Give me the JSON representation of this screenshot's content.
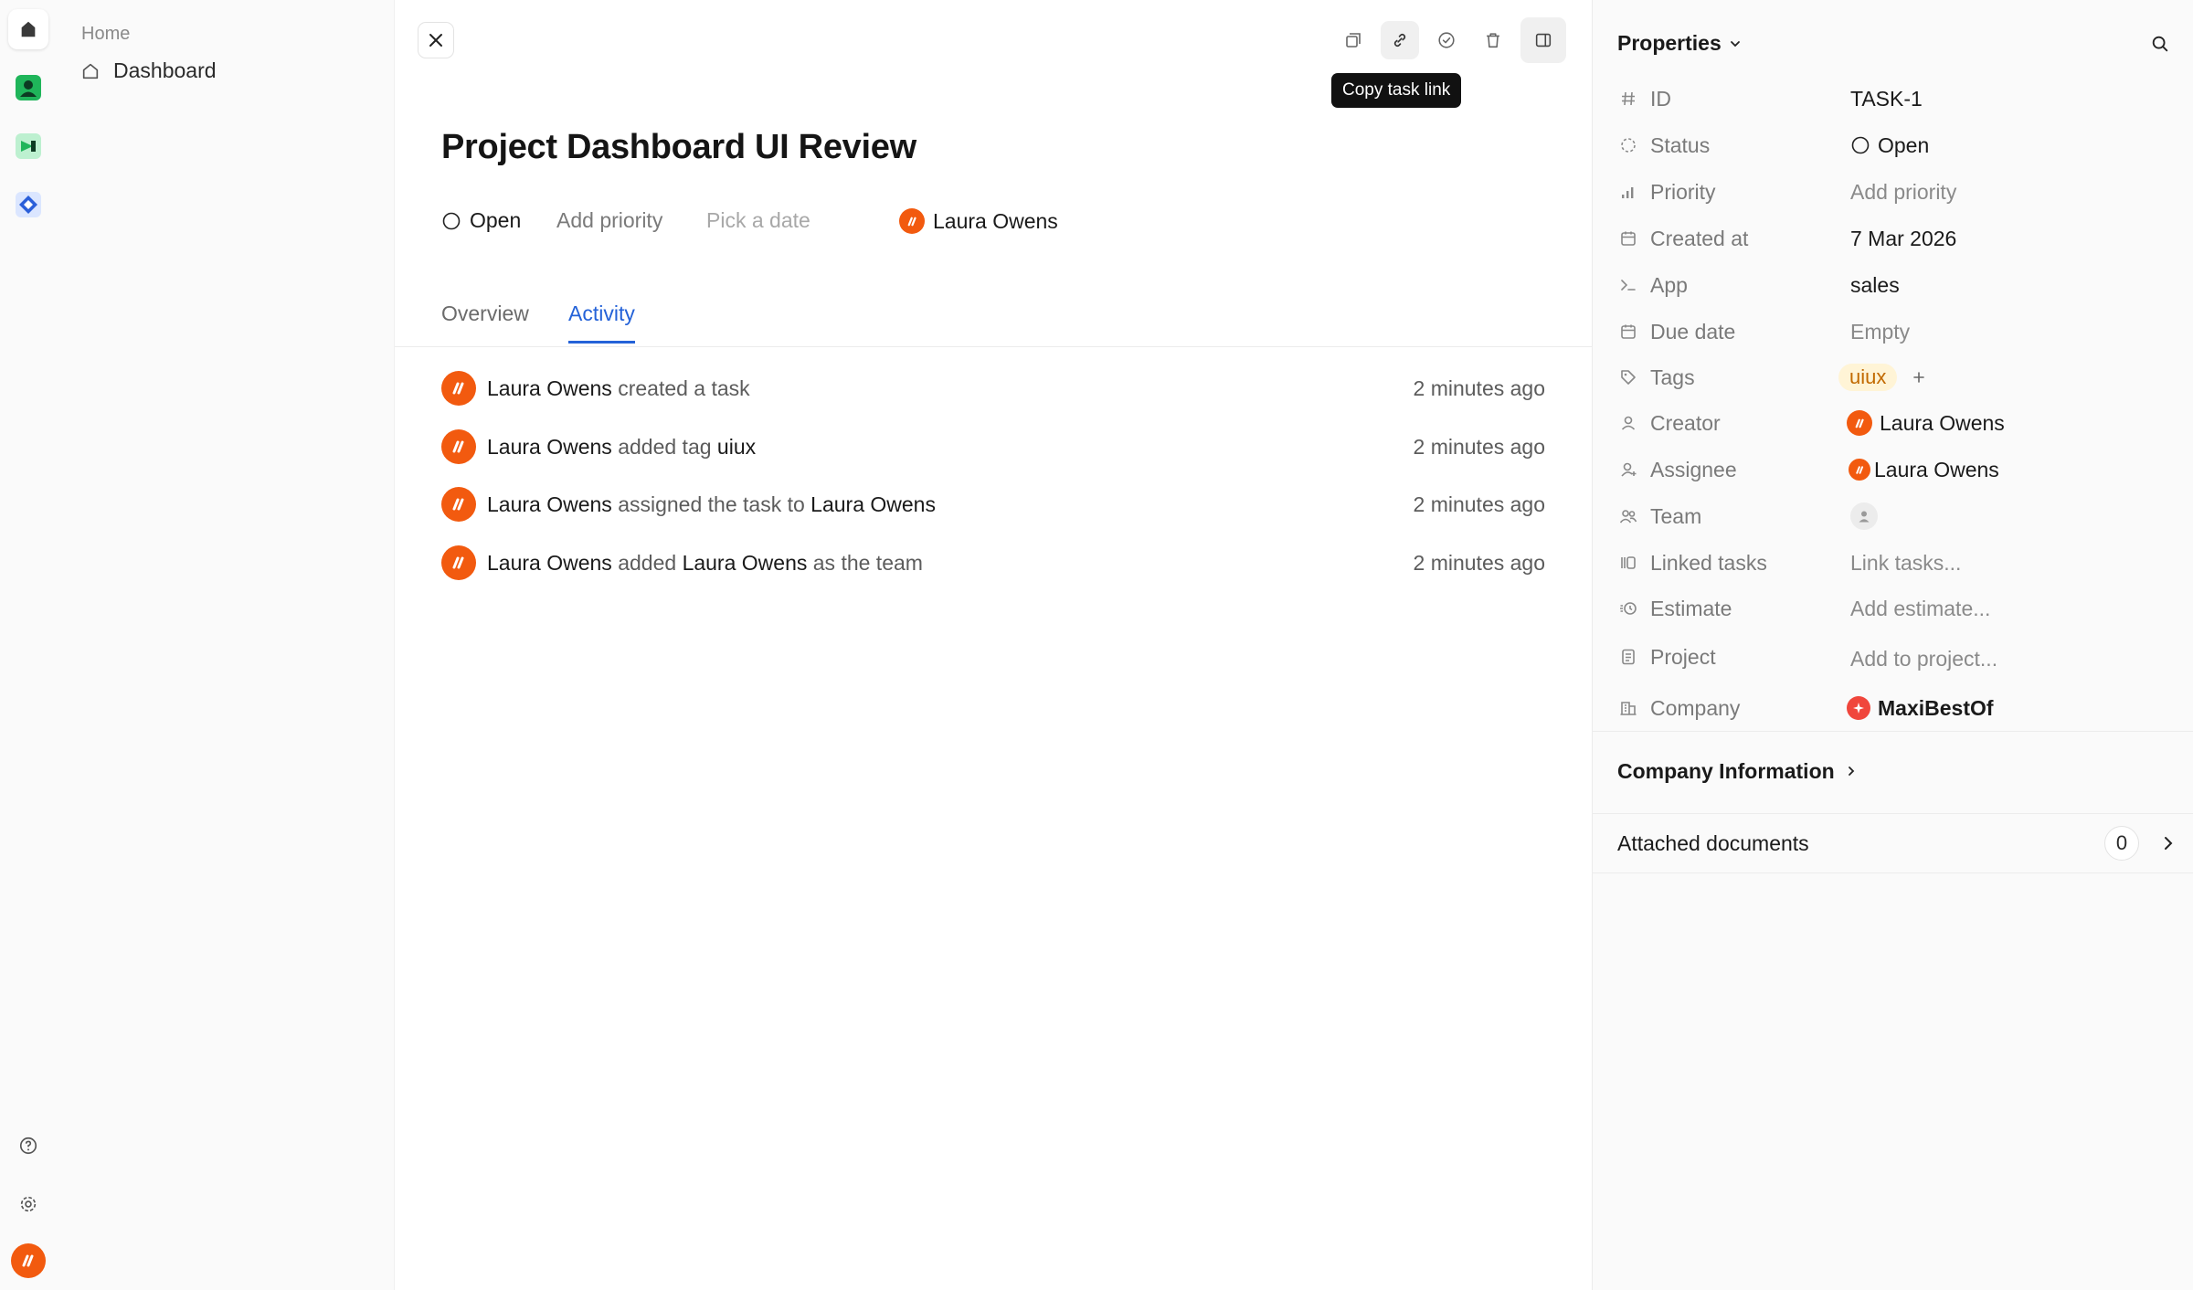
{
  "sidebar": {
    "section_label": "Home",
    "items": [
      {
        "label": "Dashboard",
        "icon": "house-icon"
      }
    ]
  },
  "toolbar": {
    "tooltip": "Copy task link",
    "icons": [
      "duplicate-icon",
      "link-icon",
      "check-circle-icon",
      "trash-icon",
      "panel-toggle-icon"
    ]
  },
  "task": {
    "title": "Project Dashboard UI Review",
    "status": "Open",
    "priority_placeholder": "Add priority",
    "date_placeholder": "Pick a date",
    "assignee": "Laura Owens"
  },
  "tabs": [
    {
      "label": "Overview",
      "active": false
    },
    {
      "label": "Activity",
      "active": true
    }
  ],
  "activity": [
    {
      "actor": "Laura Owens",
      "action": " created a task",
      "object": "",
      "suffix": "",
      "time": "2 minutes ago"
    },
    {
      "actor": "Laura Owens",
      "action": " added tag ",
      "object": "uiux",
      "suffix": "",
      "time": "2 minutes ago"
    },
    {
      "actor": "Laura Owens",
      "action": " assigned the task to ",
      "object": "Laura Owens",
      "suffix": "",
      "time": "2 minutes ago"
    },
    {
      "actor": "Laura Owens",
      "action": " added ",
      "object": "Laura Owens",
      "suffix": " as the team",
      "time": "2 minutes ago"
    }
  ],
  "properties": {
    "heading": "Properties",
    "id": {
      "label": "ID",
      "value": "TASK-1"
    },
    "status": {
      "label": "Status",
      "value": "Open"
    },
    "priority": {
      "label": "Priority",
      "value": "Add priority"
    },
    "created_at": {
      "label": "Created at",
      "value": "7 Mar 2026"
    },
    "app": {
      "label": "App",
      "value": "sales"
    },
    "due_date": {
      "label": "Due date",
      "value": "Empty"
    },
    "tags": {
      "label": "Tags",
      "value": "uiux"
    },
    "creator": {
      "label": "Creator",
      "value": "Laura Owens"
    },
    "assignee": {
      "label": "Assignee",
      "value": "Laura Owens"
    },
    "team": {
      "label": "Team"
    },
    "linked_tasks": {
      "label": "Linked tasks",
      "value": "Link tasks..."
    },
    "estimate": {
      "label": "Estimate",
      "value": "Add estimate..."
    },
    "project": {
      "label": "Project",
      "value": "Add to project..."
    },
    "company": {
      "label": "Company",
      "value": "MaxiBestOf"
    }
  },
  "sections": {
    "company_info": "Company Information",
    "attached_documents": "Attached documents",
    "attached_count": "0"
  },
  "colors": {
    "accent": "#2462d8",
    "avatar": "#f25a0f",
    "tag_bg": "#fff4d6",
    "tag_text": "#c26a00",
    "company_logo": "#f0463c"
  }
}
